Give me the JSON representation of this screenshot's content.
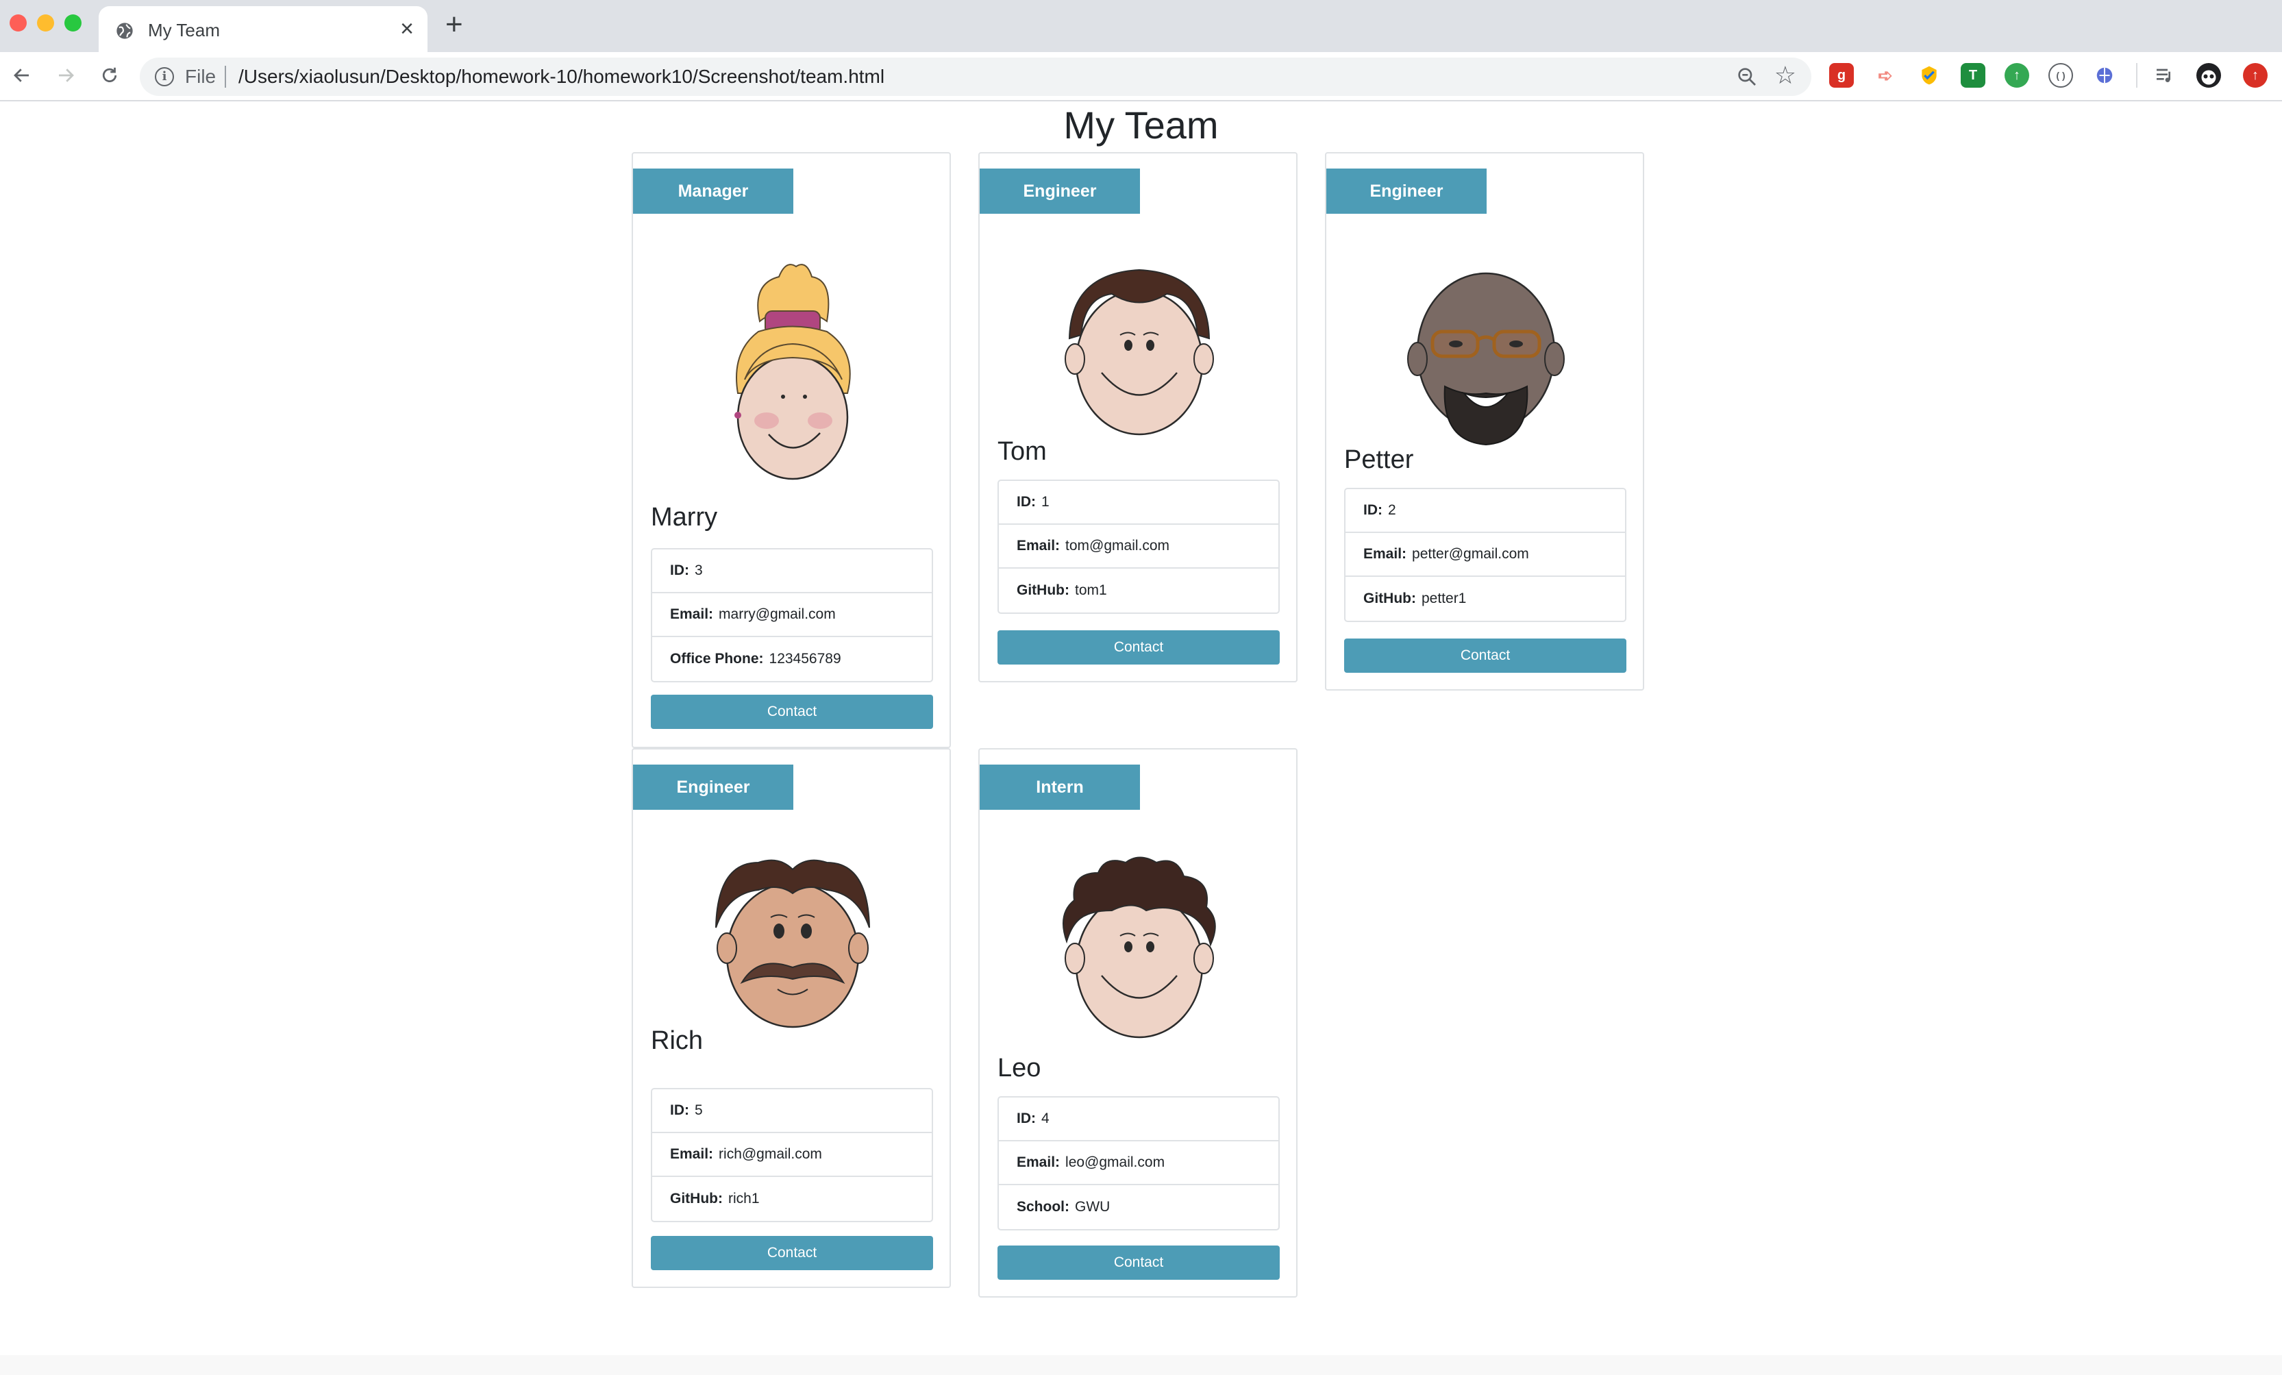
{
  "browser": {
    "tab_title": "My Team",
    "scheme_label": "File",
    "url": "/Users/xiaolusun/Desktop/homework-10/homework10/Screenshot/team.html"
  },
  "page": {
    "title": "My Team"
  },
  "team": [
    {
      "role": "Manager",
      "name": "Marry",
      "avatar_icon": "woman-blonde-bun-avatar",
      "fields": [
        {
          "label": "ID:",
          "value": "3"
        },
        {
          "label": "Email:",
          "value": "marry@gmail.com"
        },
        {
          "label": "Office Phone:",
          "value": "123456789"
        }
      ],
      "button": "Contact"
    },
    {
      "role": "Engineer",
      "name": "Tom",
      "avatar_icon": "man-brown-hair-avatar",
      "fields": [
        {
          "label": "ID:",
          "value": "1"
        },
        {
          "label": "Email:",
          "value": "tom@gmail.com"
        },
        {
          "label": "GitHub:",
          "value": "tom1"
        }
      ],
      "button": "Contact"
    },
    {
      "role": "Engineer",
      "name": "Petter",
      "avatar_icon": "bald-man-glasses-beard-avatar",
      "fields": [
        {
          "label": "ID:",
          "value": "2"
        },
        {
          "label": "Email:",
          "value": "petter@gmail.com"
        },
        {
          "label": "GitHub:",
          "value": "petter1"
        }
      ],
      "button": "Contact"
    },
    {
      "role": "Engineer",
      "name": "Rich",
      "avatar_icon": "man-mustache-avatar",
      "fields": [
        {
          "label": "ID:",
          "value": "5"
        },
        {
          "label": "Email:",
          "value": "rich@gmail.com"
        },
        {
          "label": "GitHub:",
          "value": "rich1"
        }
      ],
      "button": "Contact"
    },
    {
      "role": "Intern",
      "name": "Leo",
      "avatar_icon": "boy-curly-hair-avatar",
      "fields": [
        {
          "label": "ID:",
          "value": "4"
        },
        {
          "label": "Email:",
          "value": "leo@gmail.com"
        },
        {
          "label": "School:",
          "value": "GWU"
        }
      ],
      "button": "Contact"
    }
  ],
  "colors": {
    "accent": "#4d9cb6",
    "card_border": "#dfe2e5"
  }
}
